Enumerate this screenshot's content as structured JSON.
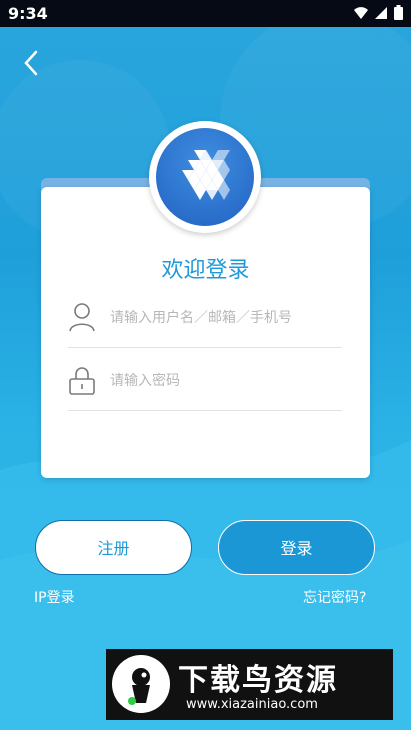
{
  "status_bar": {
    "time": "9:34",
    "icons": [
      "wifi-icon",
      "signal-icon",
      "battery-icon"
    ]
  },
  "navigation": {
    "back_icon": "chevron-left-icon"
  },
  "login_card": {
    "title": "欢迎登录",
    "username_placeholder": "请输入用户名／邮箱／手机号",
    "password_placeholder": "请输入密码",
    "username_icon": "user-icon",
    "password_icon": "lock-icon"
  },
  "actions": {
    "register_label": "注册",
    "login_label": "登录",
    "ip_login_label": "IP登录",
    "forgot_password_label": "忘记密码?"
  },
  "watermark": {
    "title": "下载鸟资源",
    "url": "www.xiazainiao.com"
  },
  "colors": {
    "accent": "#1f9ad8",
    "background": "#2aa6dd",
    "card": "#ffffff"
  }
}
